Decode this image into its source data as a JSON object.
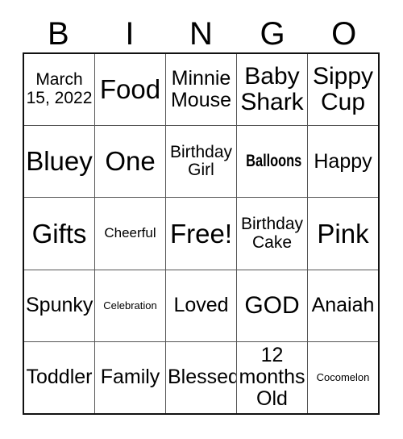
{
  "card": {
    "header_letters": [
      "B",
      "I",
      "N",
      "G",
      "O"
    ],
    "rows": [
      [
        {
          "text": "March 15, 2022",
          "size": "sm",
          "style": "normal"
        },
        {
          "text": "Food",
          "size": "xl",
          "style": "normal"
        },
        {
          "text": "Minnie Mouse",
          "size": "md",
          "style": "normal"
        },
        {
          "text": "Baby Shark",
          "size": "lg",
          "style": "normal"
        },
        {
          "text": "Sippy Cup",
          "size": "lg",
          "style": "normal"
        }
      ],
      [
        {
          "text": "Bluey",
          "size": "xl",
          "style": "normal"
        },
        {
          "text": "One",
          "size": "xl",
          "style": "normal"
        },
        {
          "text": "Birthday Girl",
          "size": "sm",
          "style": "normal"
        },
        {
          "text": "Balloons",
          "size": "sm",
          "style": "bold-condensed"
        },
        {
          "text": "Happy",
          "size": "md",
          "style": "normal"
        }
      ],
      [
        {
          "text": "Gifts",
          "size": "xl",
          "style": "normal"
        },
        {
          "text": "Cheerful",
          "size": "xs",
          "style": "normal"
        },
        {
          "text": "Free!",
          "size": "xl",
          "style": "normal"
        },
        {
          "text": "Birthday Cake",
          "size": "sm",
          "style": "normal"
        },
        {
          "text": "Pink",
          "size": "xl",
          "style": "normal"
        }
      ],
      [
        {
          "text": "Spunky",
          "size": "md",
          "style": "normal"
        },
        {
          "text": "Celebration",
          "size": "xxs",
          "style": "normal"
        },
        {
          "text": "Loved",
          "size": "md",
          "style": "normal"
        },
        {
          "text": "GOD",
          "size": "lg",
          "style": "normal"
        },
        {
          "text": "Anaiah",
          "size": "md",
          "style": "normal"
        }
      ],
      [
        {
          "text": "Toddler",
          "size": "md",
          "style": "normal"
        },
        {
          "text": "Family",
          "size": "md",
          "style": "normal"
        },
        {
          "text": "Blessed",
          "size": "md",
          "style": "normal"
        },
        {
          "text": "12 months Old",
          "size": "md",
          "style": "normal"
        },
        {
          "text": "Cocomelon",
          "size": "xxs",
          "style": "normal"
        }
      ]
    ]
  }
}
